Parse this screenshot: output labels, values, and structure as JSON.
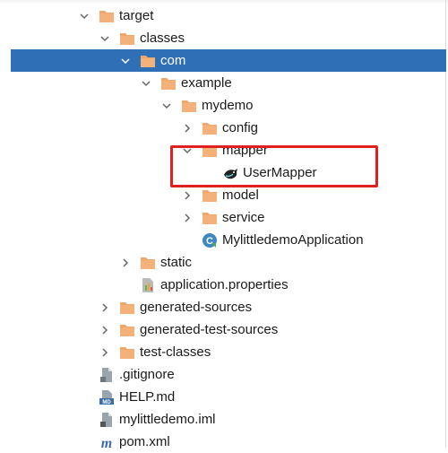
{
  "tree": {
    "items": [
      {
        "label": "target",
        "icon": "folder-icon",
        "chevron": "down",
        "level": 1
      },
      {
        "label": "classes",
        "icon": "folder-icon",
        "chevron": "down",
        "level": 2
      },
      {
        "label": "com",
        "icon": "folder-icon",
        "chevron": "down",
        "level": 3,
        "selected": true
      },
      {
        "label": "example",
        "icon": "folder-icon",
        "chevron": "down",
        "level": 4
      },
      {
        "label": "mydemo",
        "icon": "folder-icon",
        "chevron": "down",
        "level": 5
      },
      {
        "label": "config",
        "icon": "folder-icon",
        "chevron": "right",
        "level": 6
      },
      {
        "label": "mapper",
        "icon": "folder-icon",
        "chevron": "down",
        "level": 6
      },
      {
        "label": "UserMapper",
        "icon": "mybatis-bird-icon",
        "chevron": "none",
        "level": 7
      },
      {
        "label": "model",
        "icon": "folder-icon",
        "chevron": "right",
        "level": 6
      },
      {
        "label": "service",
        "icon": "folder-icon",
        "chevron": "right",
        "level": 6
      },
      {
        "label": "MylittledemoApplication",
        "icon": "java-class-icon",
        "chevron": "none",
        "level": 6
      },
      {
        "label": "static",
        "icon": "folder-icon",
        "chevron": "right",
        "level": 3
      },
      {
        "label": "application.properties",
        "icon": "properties-file-icon",
        "chevron": "none",
        "level": 3
      },
      {
        "label": "generated-sources",
        "icon": "folder-icon",
        "chevron": "right",
        "level": 2
      },
      {
        "label": "generated-test-sources",
        "icon": "folder-icon",
        "chevron": "right",
        "level": 2
      },
      {
        "label": "test-classes",
        "icon": "folder-icon",
        "chevron": "right",
        "level": 2
      },
      {
        "label": ".gitignore",
        "icon": "gitignore-file-icon",
        "chevron": "none",
        "level": 1
      },
      {
        "label": "HELP.md",
        "icon": "markdown-file-icon",
        "chevron": "none",
        "level": 1
      },
      {
        "label": "mylittledemo.iml",
        "icon": "iml-file-icon",
        "chevron": "none",
        "level": 1
      },
      {
        "label": "pom.xml",
        "icon": "maven-pom-icon",
        "chevron": "none",
        "level": 1
      }
    ]
  },
  "colors": {
    "selection": "#2f6fb5",
    "folder": "#f0a86a",
    "highlight_box": "#e0201f"
  }
}
